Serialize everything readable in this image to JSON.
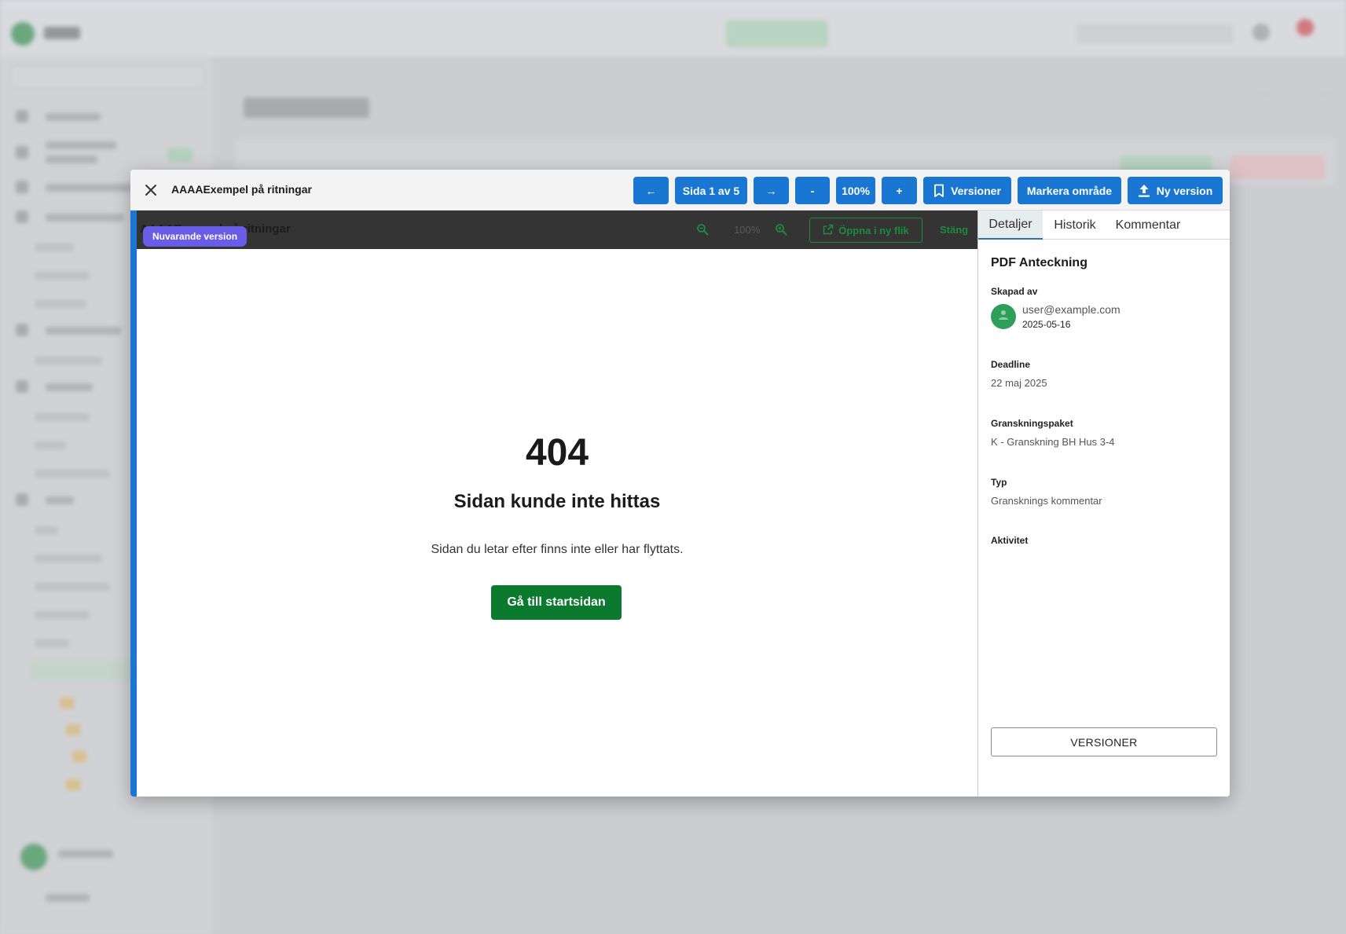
{
  "modal": {
    "title": "AAAAExempel på ritningar",
    "toolbar": {
      "prev_label": "←",
      "page_label": "Sida 1 av 5",
      "next_label": "→",
      "zoom_out_label": "-",
      "zoom_label": "100%",
      "zoom_in_label": "+",
      "versions_label": "Versioner",
      "mark_area_label": "Markera område",
      "new_version_label": "Ny version"
    }
  },
  "viewer": {
    "doc_title": "AAAAExempel på ritningar",
    "current_version_badge": "Nuvarande version",
    "zoom_level": "100%",
    "open_new_tab_label": "Öppna i ny flik",
    "close_label": "Stäng",
    "progress": 1.0,
    "error": {
      "code": "404",
      "title": "Sidan kunde inte hittas",
      "description": "Sidan du letar efter finns inte eller har flyttats.",
      "button_label": "Gå till startsidan"
    }
  },
  "panel": {
    "tabs": [
      "Detaljer",
      "Historik",
      "Kommentar"
    ],
    "active_tab": "Detaljer",
    "heading": "PDF Anteckning",
    "created_by_label": "Skapad av",
    "created_by_email": "user@example.com",
    "created_date": "2025-05-16",
    "deadline_label": "Deadline",
    "deadline_value": "22 maj 2025",
    "package_label": "Granskningspaket",
    "package_value": "K - Granskning BH Hus 3-4",
    "type_label": "Typ",
    "type_value": "Gransknings kommentar",
    "activity_label": "Aktivitet",
    "versions_button": "VERSIONER"
  },
  "colors": {
    "primary": "#1976d2",
    "success": "#0b7a2f",
    "badge": "#6b5ce7",
    "viewer_toolbar": "#343434"
  }
}
